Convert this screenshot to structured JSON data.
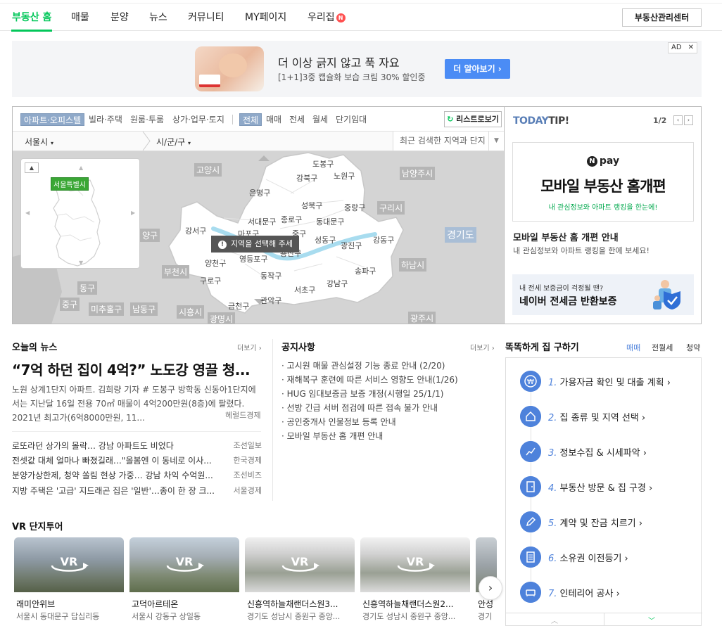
{
  "nav": {
    "items": [
      "부동산 홈",
      "매물",
      "분양",
      "뉴스",
      "커뮤니티",
      "MY페이지",
      "우리집"
    ],
    "badge": "N",
    "manager_button": "부동산관리센터"
  },
  "ad": {
    "title": "더 이상 긁지 않고 푹 자요",
    "subtitle": "[1+1]3중 캡슐화 보습 크림 30% 할인중",
    "button": "더 알아보기 ›",
    "badge": "AD",
    "close": "✕"
  },
  "map": {
    "property_tabs": [
      "아파트·오피스텔",
      "빌라·주택",
      "원룸·투룸",
      "상가·업무·토지"
    ],
    "deal_tabs": [
      "전체",
      "매매",
      "전세",
      "월세",
      "단기임대"
    ],
    "list_button": "리스트로보기",
    "city_select": "서울시",
    "district_select": "시/군/구",
    "recent_search": "최근 검색한 지역과 단지",
    "minimap_tag": "서울특별시",
    "tooltip": "지역을 선택해 주세요.",
    "district_labels": [
      "도봉구",
      "강북구",
      "노원구",
      "은평구",
      "성북구",
      "중랑구",
      "서대문구",
      "종로구",
      "동대문구",
      "마포구",
      "중구",
      "강서구",
      "성동구",
      "광진구",
      "강동구",
      "양천구",
      "영등포구",
      "용산구",
      "송파구",
      "구로구",
      "동작구",
      "서초구",
      "강남구",
      "관악구",
      "금천구"
    ],
    "city_labels": [
      "고양시",
      "남양주시",
      "구리시",
      "부천시",
      "하남시",
      "시흥시",
      "광명시",
      "광주시",
      "미추홀구",
      "남동구"
    ],
    "side_labels": [
      "양구",
      "동구",
      "중구"
    ],
    "region_big": "경기도"
  },
  "tip": {
    "heading_a": "TODAY",
    "heading_b": "TIP!",
    "page": "1/2",
    "npay_n": "N",
    "npay": "pay",
    "banner_title": "모바일 부동산 홈개편",
    "banner_sub": "내 관심정보와 아파트 랭킹을 한눈에!",
    "title": "모바일 부동산 홈 개편 안내",
    "desc": "내 관심정보와 아파트 랭킹을 한에 보세요!",
    "bottom_small": "내 전세 보증금이 걱정될 땐?",
    "bottom_big": "네이버 전세금 반환보증"
  },
  "news": {
    "title": "오늘의 뉴스",
    "more": "더보기 ›",
    "headline": "“7억 하던 집이 4억?” 노도강 영끌 청...",
    "body": "노원 상계1단지 아파트. 김희량 기자 # 도봉구 방학동 신동아1단지에서는 지난달 16일 전용 70㎡ 매물이 4억200만원(8층)에 팔렸다. 2021년 최고가(6억8000만원, 11...",
    "headline_source": "헤럴드경제",
    "rows": [
      {
        "title": "로또라던 상가의 몰락… 강남 아파트도 비었다",
        "source": "조선일보"
      },
      {
        "title": "전셋값 대체 얼마나 빠졌길래…\"올봄엔 이 동네로 이사...",
        "source": "한국경제"
      },
      {
        "title": "분양가상한제, 청약 쏠림 현상 가중… 강남 차익 수억원...",
        "source": "조선비즈"
      },
      {
        "title": "지방 주택은 '고급' 지드래곤 집은 '일반'…종이 한 장 크...",
        "source": "서울경제"
      }
    ]
  },
  "notice": {
    "title": "공지사항",
    "more": "더보기 ›",
    "items": [
      "고시원 매물 관심설정 기능 종료 안내 (2/20)",
      "재해복구 훈련에 따른 서비스 영향도 안내(1/26)",
      "HUG 임대보증금 보증 개정(시행일 25/1/1)",
      "선방 긴급 서버 점검에 따른 접속 불가 안내",
      "공인중개사 인물정보 등록 안내",
      "모바일 부동산 홈 개편 안내"
    ]
  },
  "smart": {
    "title": "똑똑하게 집 구하기",
    "tabs": [
      "매매",
      "전월세",
      "청약"
    ],
    "steps": [
      {
        "num": "1.",
        "label": "가용자금 확인 및 대출 계획 ›",
        "icon": "won-icon"
      },
      {
        "num": "2.",
        "label": "집 종류 및 지역 선택 ›",
        "icon": "home-icon"
      },
      {
        "num": "3.",
        "label": "정보수집 & 시세파악 ›",
        "icon": "chart-icon"
      },
      {
        "num": "4.",
        "label": "부동산 방문 & 집 구경 ›",
        "icon": "door-icon"
      },
      {
        "num": "5.",
        "label": "계약 및 잔금 치르기 ›",
        "icon": "pen-icon"
      },
      {
        "num": "6.",
        "label": "소유권 이전등기 ›",
        "icon": "document-icon"
      },
      {
        "num": "7.",
        "label": "인테리어 공사 ›",
        "icon": "sofa-icon"
      }
    ]
  },
  "vr": {
    "title": "VR 단지투어",
    "vr_label": "VR",
    "cards": [
      {
        "name": "래미안위브",
        "addr": "서울시 동대문구 답십리동"
      },
      {
        "name": "고덕아르테온",
        "addr": "서울시 강동구 상일동"
      },
      {
        "name": "신흥역하늘채랜더스원3...",
        "addr": "경기도 성남시 중원구 중앙..."
      },
      {
        "name": "신흥역하늘채랜더스원2...",
        "addr": "경기도 성남시 중원구 중앙..."
      },
      {
        "name": "안성",
        "addr": "경기"
      }
    ],
    "next": "›"
  }
}
